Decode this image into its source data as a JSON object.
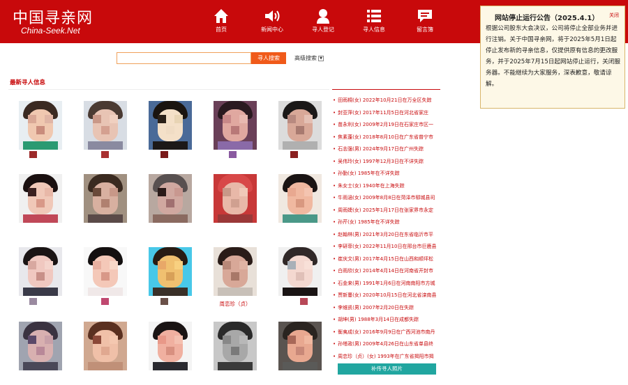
{
  "header": {
    "logo_cn": "中国寻亲网",
    "logo_en": "China-Seek.Net",
    "nav": [
      {
        "label": "首页",
        "icon": "home-icon"
      },
      {
        "label": "新闻中心",
        "icon": "speaker-icon"
      },
      {
        "label": "寻人登记",
        "icon": "person-icon"
      },
      {
        "label": "寻人信息",
        "icon": "list-icon"
      },
      {
        "label": "留言簿",
        "icon": "message-icon"
      }
    ]
  },
  "search": {
    "value": "",
    "button_label": "寻人搜索",
    "advanced_label": "高级搜索"
  },
  "section": {
    "title": "最新寻人信息"
  },
  "photos": {
    "captions": [
      "",
      "",
      "",
      "",
      "",
      "",
      "",
      "",
      "",
      "",
      "",
      "",
      "",
      "周恋珍（贞）",
      "",
      "",
      "",
      "",
      "",
      ""
    ]
  },
  "list": {
    "items": [
      "田雨桐(女) 2022年10月21日在万全区失踪",
      "封亚萍(女) 2017年11月5日在河北省家庄",
      "苗永利(女) 2009年2月19日在石家庄市区一",
      "焦素蓬(女) 2018年8月10日在广东省普宁市",
      "石志强(男) 2024年9月17日在广州失踪",
      "吴伟玲(女) 1997年12月3日在不详失踪",
      "孙勤(女) 1985年在不详失踪",
      "朱女士(女) 1940年在上海失踪",
      "牛雨涵(女) 2009年8月8日在菏泽市郓城县司",
      "周雨婕(女) 2025年1月17日在张家界市永定",
      "孙芹(女) 1985年在不详失踪",
      "赵翰林(男) 2021年3月20日在东省临沂市平",
      "李研菲(女) 2022年11月10日在邢台市巨鹿县",
      "崔庆文(男) 2017年4月15日在山西和顺坪松",
      "白雨欣(女) 2014年4月14日在河南省开封市",
      "石金来(男) 1991年1月6日在河南南阳市方城",
      "贾新蔓(女) 2020年10月15日在河北省滦南县",
      "李维凯(男) 2007年2月20日在失踪",
      "胡坤(男) 1988年3月14日在成都失踪",
      "衡夷成(女) 2016年9月9日在广西河池市南丹",
      "孙塔政(男) 2009年4月26日在山东省单县终",
      "周恋珍（贞）(女) 1993年在广东省揭阳市揭"
    ],
    "upload_label": "补传寻人照片"
  },
  "notice": {
    "title": "网站停止运行公告（2025.4.1）",
    "close_label": "关闭",
    "body": "根据公司股东大会决议，公司将停止全部业务并进行注销。关于中国寻亲网，将于2025年5月1日起停止发布新的寻亲信息，仅提供原有信息的更改服务，并于2025年7月15日起网站停止运行，关闭服务器。不能继续为大家服务，深表歉意，敬请谅解。"
  },
  "colors": {
    "brand_red": "#c8090b",
    "search_orange": "#f05a1a",
    "upload_teal": "#21a6a0",
    "notice_bg": "#fdf8e7"
  }
}
